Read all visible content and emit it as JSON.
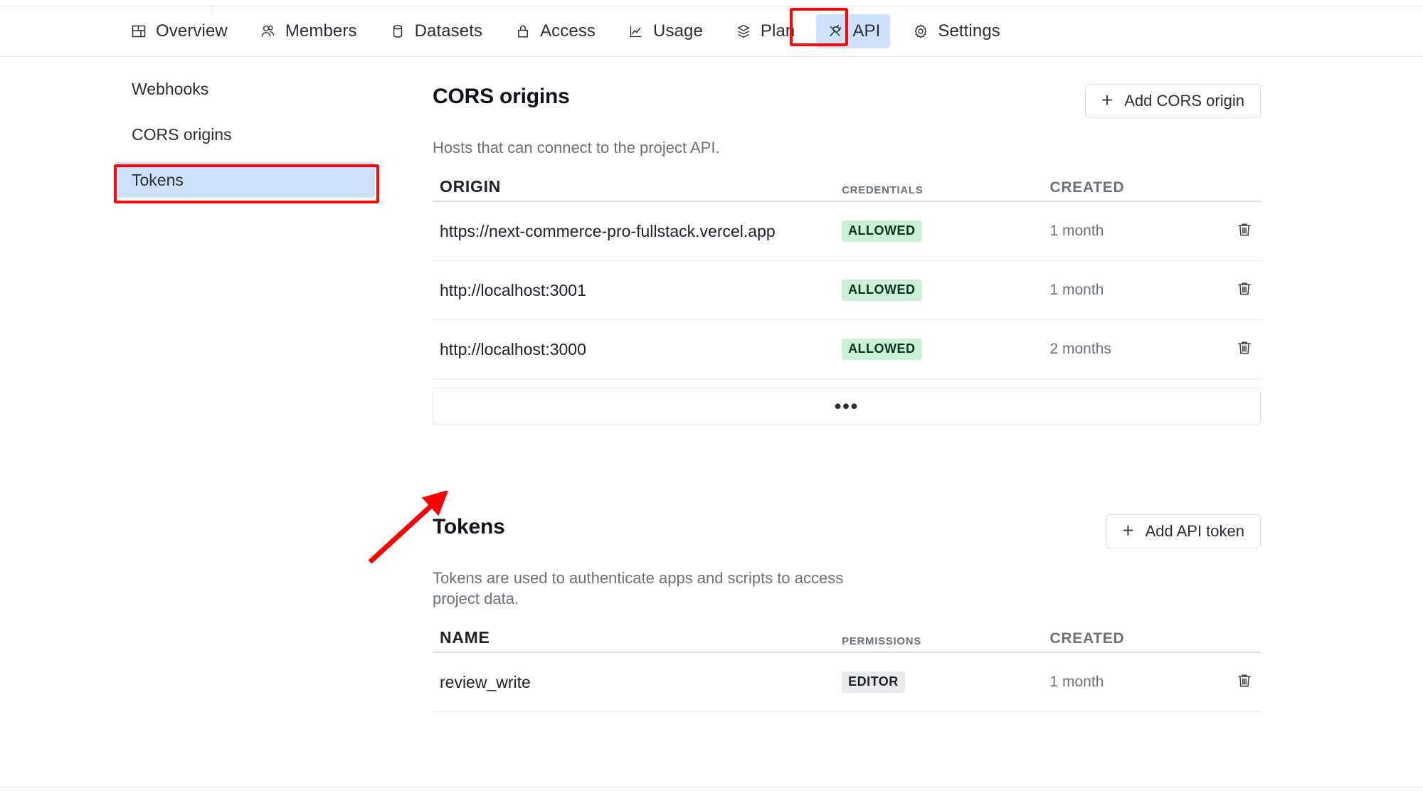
{
  "topnav": {
    "items": [
      {
        "label": "Overview",
        "icon": "layout-grid-icon",
        "active": false
      },
      {
        "label": "Members",
        "icon": "users-icon",
        "active": false
      },
      {
        "label": "Datasets",
        "icon": "database-icon",
        "active": false
      },
      {
        "label": "Access",
        "icon": "lock-icon",
        "active": false
      },
      {
        "label": "Usage",
        "icon": "chart-line-icon",
        "active": false
      },
      {
        "label": "Plan",
        "icon": "layers-icon",
        "active": false
      },
      {
        "label": "API",
        "icon": "plug-icon",
        "active": true
      },
      {
        "label": "Settings",
        "icon": "gear-icon",
        "active": false
      }
    ]
  },
  "sidebar": {
    "items": [
      {
        "label": "Webhooks",
        "active": false
      },
      {
        "label": "CORS origins",
        "active": false
      },
      {
        "label": "Tokens",
        "active": true
      }
    ]
  },
  "cors": {
    "title": "CORS origins",
    "description": "Hosts that can connect to the project API.",
    "add_label": "Add CORS origin",
    "add_icon": "plus-icon",
    "columns": [
      "ORIGIN",
      "CREDENTIALS",
      "CREATED"
    ],
    "rows": [
      {
        "origin": "https://next-commerce-pro-fullstack.vercel.app",
        "credentials": "ALLOWED",
        "created": "1 month",
        "delete_icon": "trash-icon"
      },
      {
        "origin": "http://localhost:3001",
        "credentials": "ALLOWED",
        "created": "1 month",
        "delete_icon": "trash-icon"
      },
      {
        "origin": "http://localhost:3000",
        "credentials": "ALLOWED",
        "created": "2 months",
        "delete_icon": "trash-icon"
      }
    ],
    "more_label": "•••"
  },
  "tokens": {
    "title": "Tokens",
    "description": "Tokens are used to authenticate apps and scripts to access project data.",
    "add_label": "Add API token",
    "add_icon": "plus-icon",
    "columns": [
      "NAME",
      "PERMISSIONS",
      "CREATED"
    ],
    "rows": [
      {
        "name": "review_write",
        "permissions": "EDITOR",
        "created": "1 month",
        "delete_icon": "trash-icon"
      }
    ]
  },
  "annotations": {
    "highlight_color": "#fb0707",
    "active_bg_color": "#cfe0fa",
    "allowed_badge_color": "#caf0d7",
    "arrow_target": "Tokens"
  }
}
